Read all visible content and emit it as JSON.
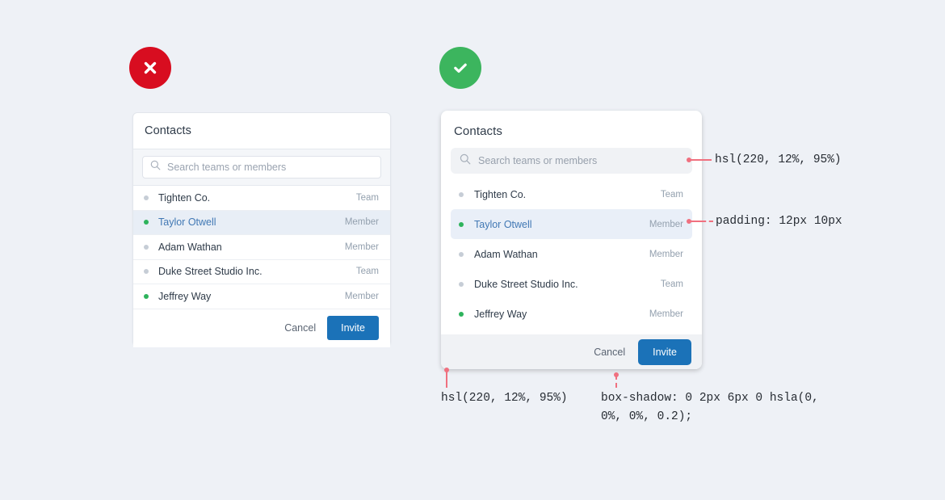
{
  "badges": {
    "bad": {
      "icon": "close-icon",
      "color": "#d80d20"
    },
    "good": {
      "icon": "check-icon",
      "color": "#3cb55e"
    }
  },
  "cards": {
    "bad": {
      "title": "Contacts",
      "search_placeholder": "Search teams or members",
      "rows": [
        {
          "name": "Tighten Co.",
          "role": "Team",
          "status": "grey",
          "selected": false
        },
        {
          "name": "Taylor Otwell",
          "role": "Member",
          "status": "green",
          "selected": true
        },
        {
          "name": "Adam Wathan",
          "role": "Member",
          "status": "grey",
          "selected": false
        },
        {
          "name": "Duke Street Studio Inc.",
          "role": "Team",
          "status": "grey",
          "selected": false
        },
        {
          "name": "Jeffrey Way",
          "role": "Member",
          "status": "green",
          "selected": false
        }
      ],
      "cancel_label": "Cancel",
      "invite_label": "Invite"
    },
    "good": {
      "title": "Contacts",
      "search_placeholder": "Search teams or members",
      "rows": [
        {
          "name": "Tighten Co.",
          "role": "Team",
          "status": "grey",
          "selected": false
        },
        {
          "name": "Taylor Otwell",
          "role": "Member",
          "status": "green",
          "selected": true
        },
        {
          "name": "Adam Wathan",
          "role": "Member",
          "status": "grey",
          "selected": false
        },
        {
          "name": "Duke Street Studio Inc.",
          "role": "Team",
          "status": "grey",
          "selected": false
        },
        {
          "name": "Jeffrey Way",
          "role": "Member",
          "status": "green",
          "selected": false
        }
      ],
      "cancel_label": "Cancel",
      "invite_label": "Invite"
    }
  },
  "annotations": {
    "search_bg": "hsl(220, 12%, 95%)",
    "row_padding": "padding: 12px 10px",
    "footer_bg": "hsl(220, 12%, 95%)",
    "card_shadow": "box-shadow: 0 2px 6px 0 hsla(0,\n0%, 0%, 0.2);"
  },
  "colors": {
    "page_bg": "#eef1f6",
    "accent_blue": "#1b72b8",
    "selected_row": "#e9eff8",
    "status_green": "#2eb35c",
    "status_grey": "#c6cdd6",
    "annotation_pink": "#f0707f"
  }
}
